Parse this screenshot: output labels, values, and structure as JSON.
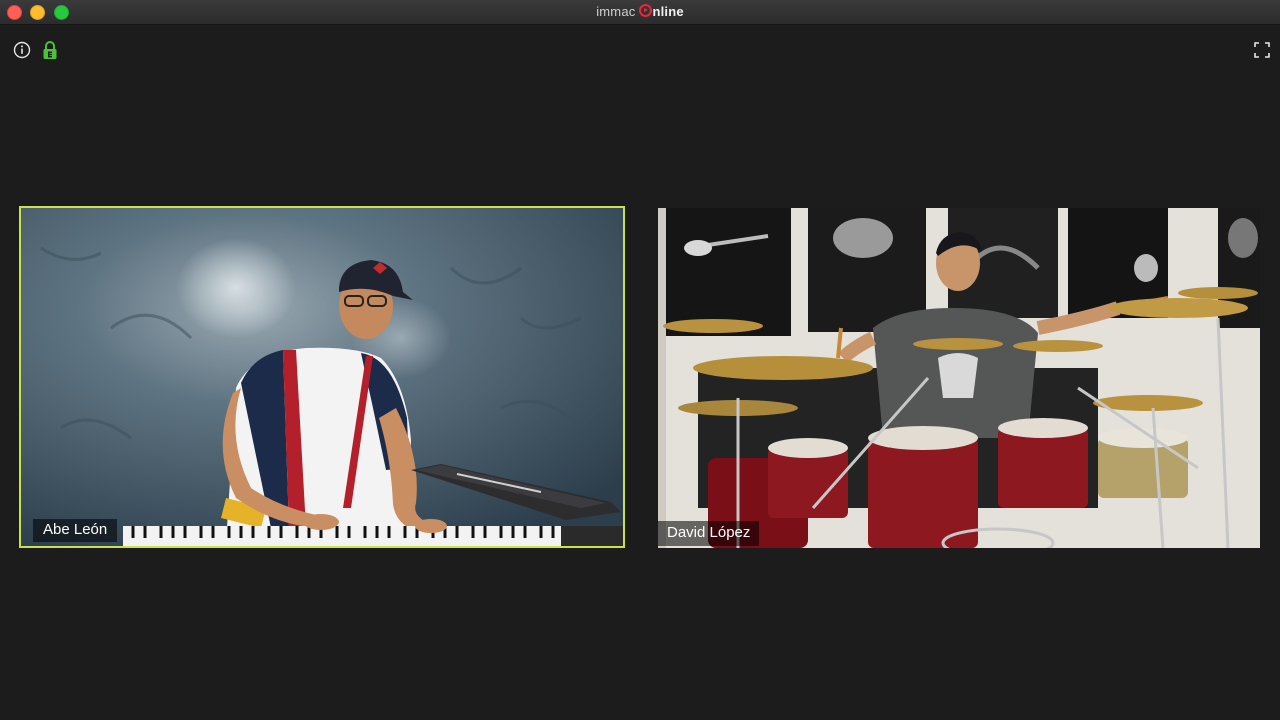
{
  "window": {
    "title_first": "immac",
    "title_second": "nline",
    "controls": {
      "close": "close-window",
      "minimize": "minimize-window",
      "maximize": "maximize-window"
    }
  },
  "toolbar": {
    "info_icon": "info-icon",
    "lock_icon": "lock-icon",
    "fullscreen_icon": "fullscreen-icon"
  },
  "participants": [
    {
      "name": "Abe León",
      "active_speaker": true,
      "highlight_color": "#c7e24a"
    },
    {
      "name": "David López",
      "active_speaker": false
    }
  ],
  "colors": {
    "background": "#1c1c1c",
    "accent_red": "#e8283a",
    "lock_green": "#4cc238"
  }
}
